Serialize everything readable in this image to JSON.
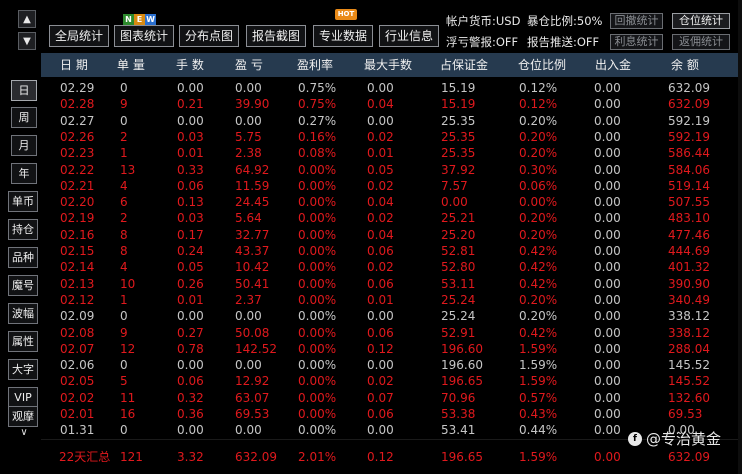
{
  "nav": {
    "up_arrow": "▲",
    "down_arrow": "▼",
    "chevron": "∨",
    "periods": [
      "日",
      "周",
      "月",
      "年"
    ],
    "filters": [
      "单币",
      "持仓",
      "品种",
      "魔号",
      "波幅",
      "属性",
      "大字",
      "VIP",
      "观摩"
    ]
  },
  "toolbar": {
    "buttons": [
      "全局统计",
      "图表统计",
      "分布点图",
      "报告截图",
      "专业数据",
      "行业信息"
    ],
    "new_badge": [
      "N",
      "E",
      "W"
    ],
    "hot_badge": "HOT",
    "account_currency": "帐户货币:USD",
    "exposure_ratio": "暴仓比例:50%",
    "float_alert": "浮亏警报:OFF",
    "report_push": "报告推送:OFF",
    "right_buttons": [
      "回撤统计",
      "仓位统计",
      "利息统计",
      "返佣统计"
    ]
  },
  "table": {
    "columns": [
      "日 期",
      "单 量",
      "手 数",
      "盈 亏",
      "盈利率",
      "最大手数",
      "占保证金",
      "仓位比例",
      "出入金",
      "余 额"
    ],
    "rows": [
      {
        "type": "gray",
        "cells": [
          "02.29",
          "0",
          "0.00",
          "0.00",
          "0.75%",
          "0.00",
          "15.19",
          "0.12%",
          "0.00",
          "632.09"
        ]
      },
      {
        "type": "red",
        "cells": [
          "02.28",
          "9",
          "0.21",
          "39.90",
          "0.75%",
          "0.04",
          "15.19",
          "0.12%",
          "0.00",
          "632.09"
        ]
      },
      {
        "type": "gray",
        "cells": [
          "02.27",
          "0",
          "0.00",
          "0.00",
          "0.27%",
          "0.00",
          "25.35",
          "0.20%",
          "0.00",
          "592.19"
        ]
      },
      {
        "type": "red",
        "cells": [
          "02.26",
          "2",
          "0.03",
          "5.75",
          "0.16%",
          "0.02",
          "25.35",
          "0.20%",
          "0.00",
          "592.19"
        ]
      },
      {
        "type": "red",
        "cells": [
          "02.23",
          "1",
          "0.01",
          "2.38",
          "0.08%",
          "0.01",
          "25.35",
          "0.20%",
          "0.00",
          "586.44"
        ]
      },
      {
        "type": "red",
        "cells": [
          "02.22",
          "13",
          "0.33",
          "64.92",
          "0.00%",
          "0.05",
          "37.92",
          "0.30%",
          "0.00",
          "584.06"
        ]
      },
      {
        "type": "red",
        "cells": [
          "02.21",
          "4",
          "0.06",
          "11.59",
          "0.00%",
          "0.02",
          "7.57",
          "0.06%",
          "0.00",
          "519.14"
        ]
      },
      {
        "type": "red",
        "cells": [
          "02.20",
          "6",
          "0.13",
          "24.45",
          "0.00%",
          "0.04",
          "0.00",
          "0.00%",
          "0.00",
          "507.55"
        ]
      },
      {
        "type": "red",
        "cells": [
          "02.19",
          "2",
          "0.03",
          "5.64",
          "0.00%",
          "0.02",
          "25.21",
          "0.20%",
          "0.00",
          "483.10"
        ]
      },
      {
        "type": "red",
        "cells": [
          "02.16",
          "8",
          "0.17",
          "32.77",
          "0.00%",
          "0.04",
          "25.20",
          "0.20%",
          "0.00",
          "477.46"
        ]
      },
      {
        "type": "red",
        "cells": [
          "02.15",
          "8",
          "0.24",
          "43.37",
          "0.00%",
          "0.06",
          "52.81",
          "0.42%",
          "0.00",
          "444.69"
        ]
      },
      {
        "type": "red",
        "cells": [
          "02.14",
          "4",
          "0.05",
          "10.42",
          "0.00%",
          "0.02",
          "52.80",
          "0.42%",
          "0.00",
          "401.32"
        ]
      },
      {
        "type": "red",
        "cells": [
          "02.13",
          "10",
          "0.26",
          "50.41",
          "0.00%",
          "0.06",
          "53.11",
          "0.42%",
          "0.00",
          "390.90"
        ]
      },
      {
        "type": "red",
        "cells": [
          "02.12",
          "1",
          "0.01",
          "2.37",
          "0.00%",
          "0.01",
          "25.24",
          "0.20%",
          "0.00",
          "340.49"
        ]
      },
      {
        "type": "gray",
        "cells": [
          "02.09",
          "0",
          "0.00",
          "0.00",
          "0.00%",
          "0.00",
          "25.24",
          "0.20%",
          "0.00",
          "338.12"
        ]
      },
      {
        "type": "red",
        "cells": [
          "02.08",
          "9",
          "0.27",
          "50.08",
          "0.00%",
          "0.06",
          "52.91",
          "0.42%",
          "0.00",
          "338.12"
        ]
      },
      {
        "type": "red",
        "cells": [
          "02.07",
          "12",
          "0.78",
          "142.52",
          "0.00%",
          "0.12",
          "196.60",
          "1.59%",
          "0.00",
          "288.04"
        ]
      },
      {
        "type": "gray",
        "cells": [
          "02.06",
          "0",
          "0.00",
          "0.00",
          "0.00%",
          "0.00",
          "196.60",
          "1.59%",
          "0.00",
          "145.52"
        ]
      },
      {
        "type": "red",
        "cells": [
          "02.05",
          "5",
          "0.06",
          "12.92",
          "0.00%",
          "0.02",
          "196.65",
          "1.59%",
          "0.00",
          "145.52"
        ]
      },
      {
        "type": "red",
        "cells": [
          "02.02",
          "11",
          "0.32",
          "63.07",
          "0.00%",
          "0.07",
          "70.96",
          "0.57%",
          "0.00",
          "132.60"
        ]
      },
      {
        "type": "red",
        "cells": [
          "02.01",
          "16",
          "0.36",
          "69.53",
          "0.00%",
          "0.06",
          "53.38",
          "0.43%",
          "0.00",
          "69.53"
        ]
      },
      {
        "type": "gray",
        "cells": [
          "01.31",
          "0",
          "0.00",
          "0.00",
          "0.00%",
          "0.00",
          "53.41",
          "0.44%",
          "0.00",
          "0.00"
        ]
      }
    ],
    "total": [
      "22天汇总",
      "121",
      "3.32",
      "632.09",
      "2.01%",
      "0.12",
      "196.65",
      "1.59%",
      "0.00",
      "632.09"
    ]
  },
  "watermark": {
    "icon": "f",
    "text": "@专治黄金"
  },
  "colors": {
    "header_bg": "#263a4f",
    "loss_red": "#e0191d",
    "neutral_gray": "#c6c6c6",
    "background": "#000000"
  }
}
